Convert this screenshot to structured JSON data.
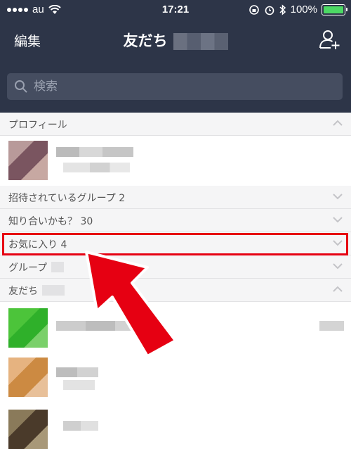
{
  "status": {
    "carrier": "au",
    "time": "17:21",
    "battery": "100%",
    "battery_level": 1.0
  },
  "header": {
    "edit_label": "編集",
    "title": "友だち"
  },
  "search": {
    "placeholder": "検索"
  },
  "sections": {
    "profile": "プロフィール",
    "invited_groups": "招待されているグループ 2",
    "suggested": "知り合いかも？ 30",
    "favorites": "お気に入り 4",
    "groups": "グループ",
    "friends": "友だち"
  },
  "colors": {
    "header_bg": "#2d3548",
    "highlight": "#e60012",
    "battery_green": "#4cd964"
  },
  "icons": {
    "add_friend": "add-friend-icon",
    "search": "search-icon",
    "chevron": "chevron-icon"
  }
}
